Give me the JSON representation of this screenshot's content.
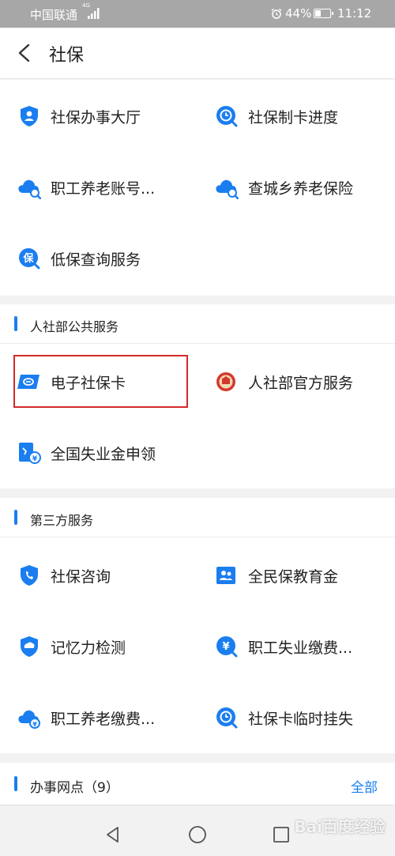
{
  "status_bar": {
    "carrier": "中国联通",
    "network": "4G",
    "battery_percent": "44%",
    "battery_level": 0.44,
    "time": "11:12"
  },
  "header": {
    "title": "社保"
  },
  "social_security_services": [
    {
      "label": "社保办事大厅",
      "icon": "shield-person-icon"
    },
    {
      "label": "社保制卡进度",
      "icon": "clock-search-icon"
    },
    {
      "label": "职工养老账号...",
      "icon": "cloud-search-icon"
    },
    {
      "label": "查城乡养老保险",
      "icon": "cloud-search-icon"
    },
    {
      "label": "低保查询服务",
      "icon": "bao-search-icon"
    }
  ],
  "hrss_section": {
    "title": "人社部公共服务",
    "items": [
      {
        "label": "电子社保卡",
        "icon": "social-security-card-icon"
      },
      {
        "label": "人社部官方服务",
        "icon": "ministry-emblem-icon"
      },
      {
        "label": "全国失业金申领",
        "icon": "unemployment-benefit-icon"
      }
    ]
  },
  "third_party_section": {
    "title": "第三方服务",
    "items": [
      {
        "label": "社保咨询",
        "icon": "phone-shield-icon"
      },
      {
        "label": "全民保教育金",
        "icon": "family-icon"
      },
      {
        "label": "记忆力检测",
        "icon": "brain-icon"
      },
      {
        "label": "职工失业缴费...",
        "icon": "yuan-search-icon"
      },
      {
        "label": "职工养老缴费...",
        "icon": "cloud-yuan-icon"
      },
      {
        "label": "社保卡临时挂失",
        "icon": "clock-search-icon"
      }
    ]
  },
  "offices_section": {
    "title": "办事网点（9）",
    "all_label": "全部"
  },
  "colors": {
    "accent": "#1a7ef0",
    "highlight_border": "#d22a2a",
    "status_bar": "#a7a7a7"
  },
  "watermark": "Bai百度经验"
}
